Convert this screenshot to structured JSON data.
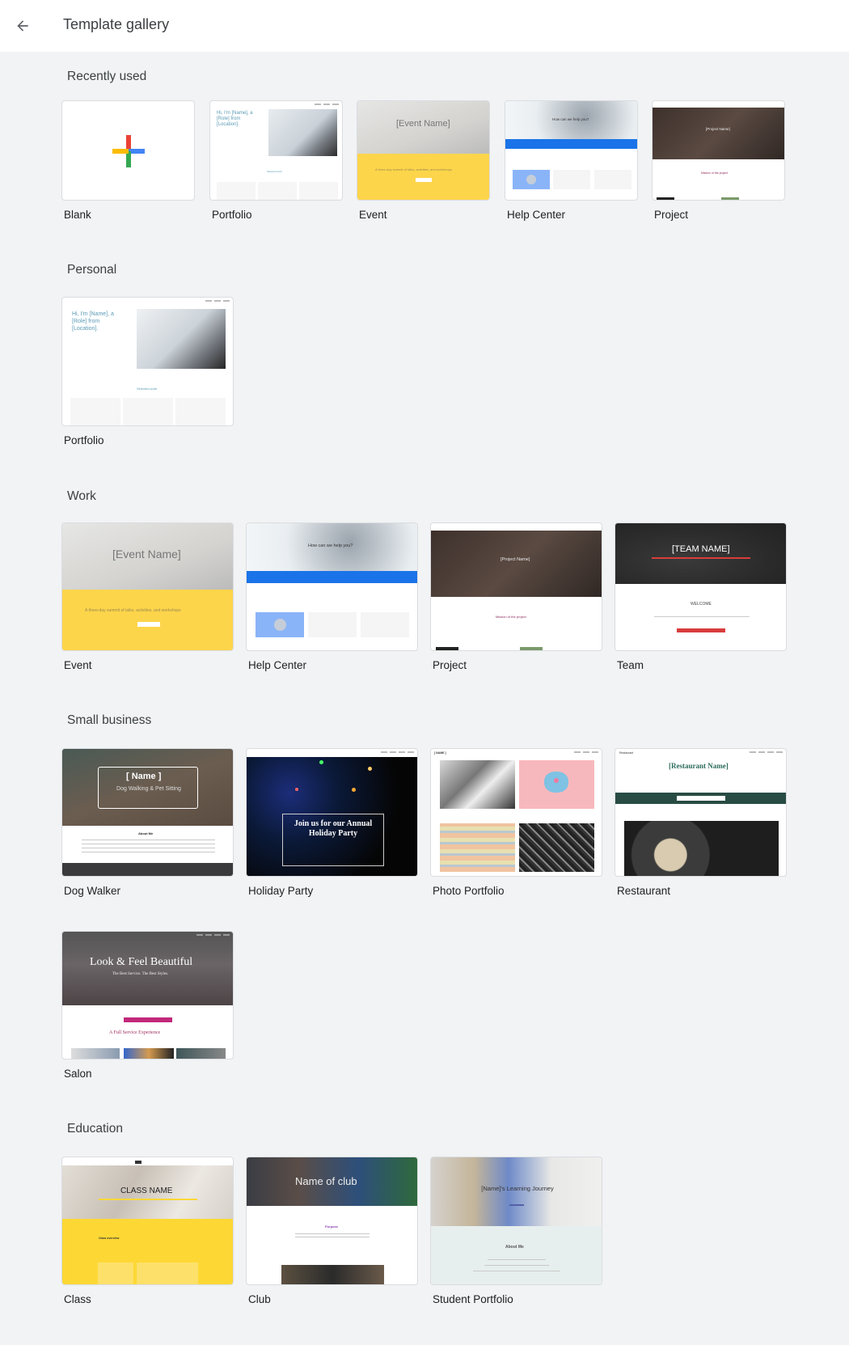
{
  "header": {
    "back_icon": "arrow-left-icon",
    "title": "Template gallery"
  },
  "sections": [
    {
      "title": "Recently used",
      "templates": [
        {
          "name": "Blank",
          "icon": "plus-icon"
        },
        {
          "name": "Portfolio",
          "preview_heading": "Hi, I'm [Name], a [Role] from [Location].",
          "preview_sub": "Selected work"
        },
        {
          "name": "Event",
          "preview_heading": "[Event Name]",
          "preview_sub": "A three-day summit of talks, activities, and workshops"
        },
        {
          "name": "Help Center",
          "preview_heading": "How can we help you?"
        },
        {
          "name": "Project",
          "preview_heading": "[Project Name]",
          "preview_sub": "Mission of the project"
        }
      ]
    },
    {
      "title": "Personal",
      "templates": [
        {
          "name": "Portfolio",
          "preview_heading": "Hi, I'm [Name], a [Role] from [Location].",
          "preview_sub": "Selected work"
        }
      ]
    },
    {
      "title": "Work",
      "templates": [
        {
          "name": "Event",
          "preview_heading": "[Event Name]",
          "preview_sub": "A three-day summit of talks, activities, and workshops"
        },
        {
          "name": "Help Center",
          "preview_heading": "How can we help you?"
        },
        {
          "name": "Project",
          "preview_heading": "[Project Name]",
          "preview_sub": "Mission of the project"
        },
        {
          "name": "Team",
          "preview_heading": "[TEAM NAME]",
          "preview_sub": "WELCOME"
        }
      ]
    },
    {
      "title": "Small business",
      "templates": [
        {
          "name": "Dog Walker",
          "preview_heading": "[ Name ]",
          "preview_sub": "Dog Walking & Pet Sitting",
          "preview_section": "About Me"
        },
        {
          "name": "Holiday Party",
          "preview_heading": "Join us for our Annual Holiday Party"
        },
        {
          "name": "Photo Portfolio",
          "preview_heading": "[ NAME ]"
        },
        {
          "name": "Restaurant",
          "preview_heading": "[Restaurant Name]",
          "preview_nav": "Restaurant"
        }
      ]
    },
    {
      "title": "",
      "templates": [
        {
          "name": "Salon",
          "preview_heading": "Look & Feel Beautiful",
          "preview_sub": "The Best Service. The Best Styles.",
          "preview_section": "A Full Service Experience"
        }
      ]
    },
    {
      "title": "Education",
      "templates": [
        {
          "name": "Class",
          "preview_heading": "CLASS NAME",
          "preview_sub": "Class overview"
        },
        {
          "name": "Club",
          "preview_heading": "Name of club",
          "preview_sub": "Purpose"
        },
        {
          "name": "Student Portfolio",
          "preview_heading": "[Name]'s Learning Journey",
          "preview_sub": "About Me"
        }
      ]
    }
  ],
  "colors": {
    "background": "#f1f3f4",
    "help_blue": "#1a73e8",
    "event_yellow": "#fdd54b",
    "team_red": "#d93c3c",
    "restaurant_green": "#284c43",
    "salon_pink": "#c2287a",
    "class_yellow": "#fdd835",
    "plus_red": "#ea4335",
    "plus_blue": "#4285f4",
    "plus_green": "#34a853",
    "plus_yellow": "#fbbc04"
  }
}
